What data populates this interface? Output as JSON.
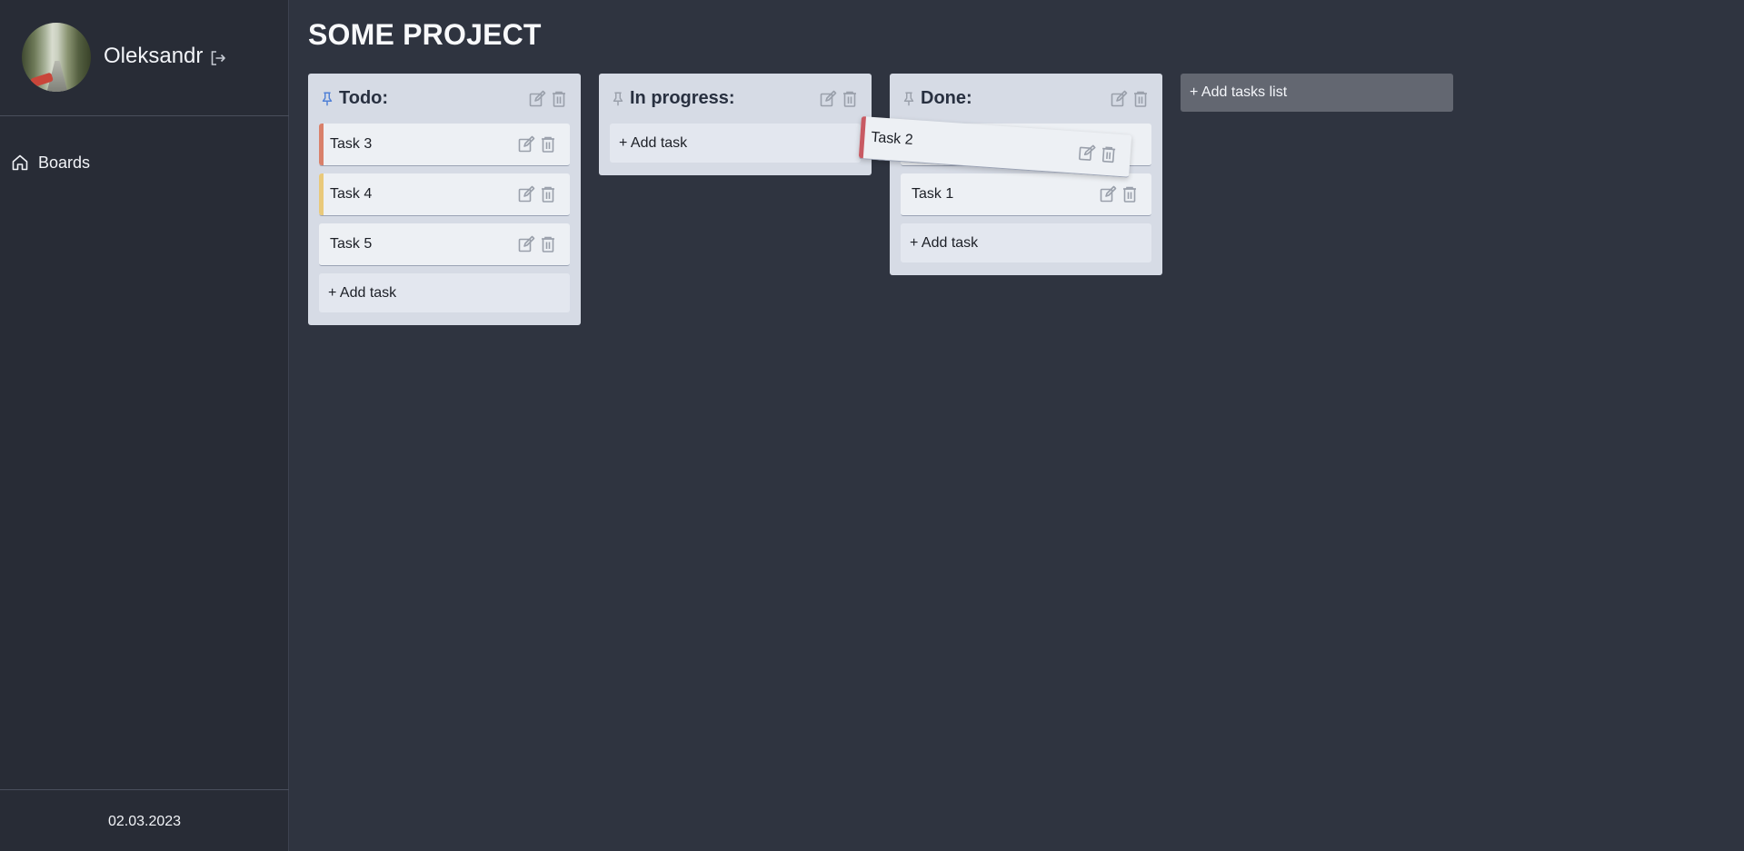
{
  "sidebar": {
    "user": {
      "name": "Oleksandr"
    },
    "nav": [
      {
        "label": "Boards",
        "icon": "home-icon"
      }
    ],
    "date": "02.03.2023"
  },
  "board": {
    "title": "SOME PROJECT",
    "add_list_label": "+ Add tasks list",
    "add_task_label": "+ Add task",
    "lists": [
      {
        "title": "Todo:",
        "tasks": [
          {
            "title": "Task 3",
            "color": "#d9806a"
          },
          {
            "title": "Task 4",
            "color": "#e9c97a"
          },
          {
            "title": "Task 5",
            "color": ""
          }
        ]
      },
      {
        "title": "In progress:",
        "tasks": []
      },
      {
        "title": "Done:",
        "tasks": [
          {
            "title": "Task 1",
            "color": ""
          }
        ]
      }
    ],
    "dragging_task": {
      "title": "Task 2",
      "color": "#c85a63"
    }
  },
  "colors": {
    "background": "#2f3440",
    "sidebar": "#282c36",
    "list": "#d6dbe5",
    "card": "#edf0f4",
    "add_list": "#636771",
    "pin_active": "#4f7fd6",
    "icon_muted": "#9aa0ab"
  },
  "icons": {
    "logout": "logout-icon",
    "pin": "pin-icon",
    "edit": "edit-icon",
    "delete": "trash-icon"
  }
}
